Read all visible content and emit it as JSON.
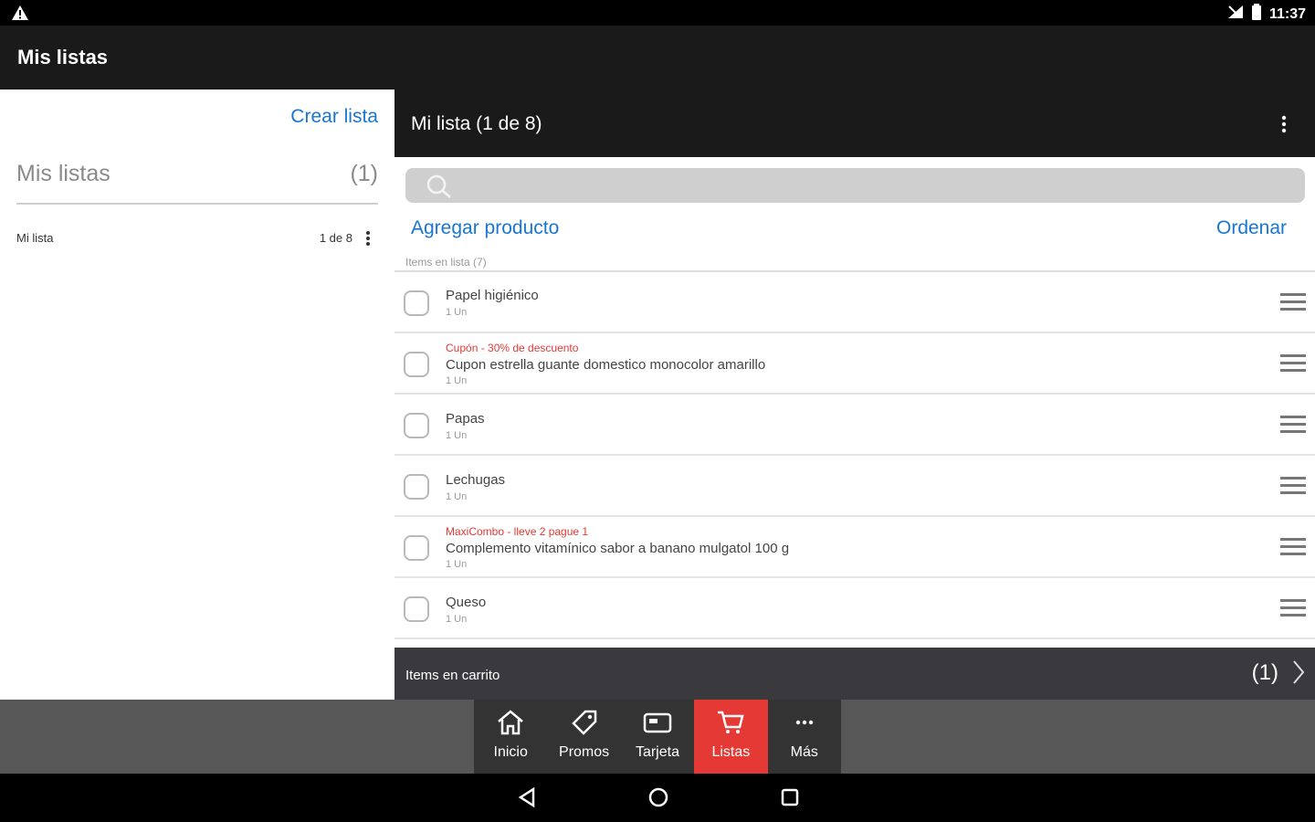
{
  "status_bar": {
    "time": "11:37"
  },
  "app_bar": {
    "title": "Mis listas"
  },
  "left_panel": {
    "create_list": "Crear lista",
    "header_label": "Mis listas",
    "header_count": "(1)",
    "lists": [
      {
        "name": "Mi lista",
        "position": "1 de 8"
      }
    ]
  },
  "detail": {
    "title": "Mi lista (1 de 8)",
    "search_placeholder": "",
    "add_product": "Agregar producto",
    "sort": "Ordenar",
    "items_caption": "Items en lista (7)",
    "items": [
      {
        "promo": "",
        "name": "Papel higiénico",
        "qty": "1 Un"
      },
      {
        "promo": "Cupón - 30% de descuento",
        "name": "Cupon estrella guante domestico monocolor amarillo",
        "qty": "1 Un"
      },
      {
        "promo": "",
        "name": "Papas",
        "qty": "1 Un"
      },
      {
        "promo": "",
        "name": "Lechugas",
        "qty": "1 Un"
      },
      {
        "promo": "MaxiCombo - lleve 2 pague 1",
        "name": "Complemento vitamínico sabor a banano mulgatol 100 g",
        "qty": "1 Un"
      },
      {
        "promo": "",
        "name": "Queso",
        "qty": "1 Un"
      }
    ]
  },
  "cart_bar": {
    "label": "Items en carrito",
    "count": "(1)"
  },
  "tabs": [
    {
      "label": "Inicio",
      "icon": "home-icon"
    },
    {
      "label": "Promos",
      "icon": "tag-icon"
    },
    {
      "label": "Tarjeta",
      "icon": "card-icon"
    },
    {
      "label": "Listas",
      "icon": "cart-icon",
      "active": true
    },
    {
      "label": "Más",
      "icon": "more-icon"
    }
  ],
  "colors": {
    "accent_blue": "#1976d2",
    "accent_red": "#e53935",
    "dark_bar": "#1a1a1a",
    "cart_bar": "#3a3a3e"
  }
}
